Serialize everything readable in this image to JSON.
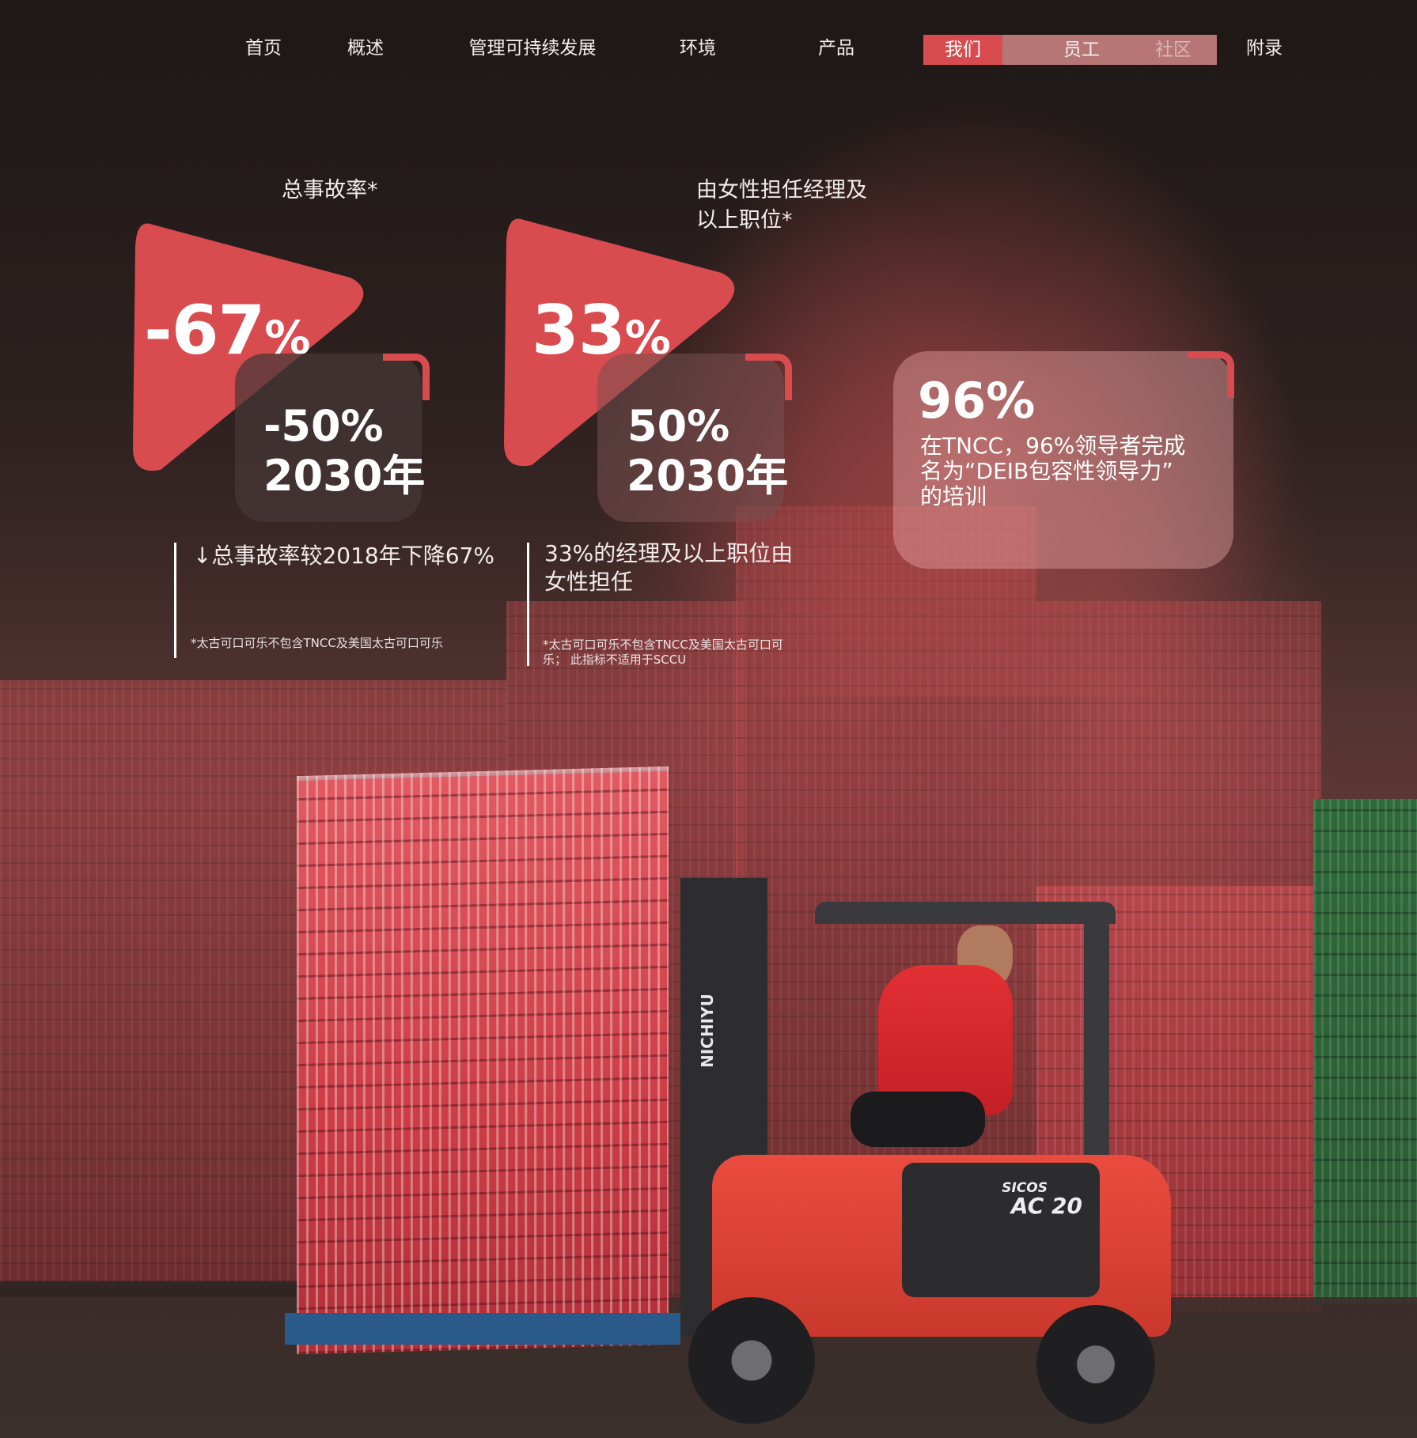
{
  "nav": {
    "items": [
      "首页",
      "概述",
      "管理可持续发展",
      "环境",
      "产品",
      "我们",
      "员工",
      "社区",
      "附录"
    ],
    "active": "我们"
  },
  "stats": {
    "accident": {
      "label": "总事故率*",
      "value": "-67",
      "pct": "%",
      "target_value": "-50%",
      "target_year": "2030年",
      "desc": "↓总事故率较2018年下降67%",
      "footnote": "*太古可口可乐不包含TNCC及美国太古可口可乐"
    },
    "women": {
      "label_line1": "由女性担任经理及",
      "label_line2": "以上职位*",
      "value": "33",
      "pct": "%",
      "target_value": "50%",
      "target_year": "2030年",
      "desc_line1": "33%的经理及以上职位由",
      "desc_line2": "女性担任",
      "footnote_line1": "*太古可口可乐不包含TNCC及美国太古可口可",
      "footnote_line2": "乐； 此指标不适用于SCCU"
    },
    "training": {
      "value": "96%",
      "desc_line1": "在TNCC，96%领导者完成",
      "desc_line2": "名为“DEIB包容性领导力”",
      "desc_line3": "的培训"
    }
  },
  "colors": {
    "accent": "#d84b4f",
    "card": "#463737",
    "nav_active_bg": "#d84b4f",
    "nav_group_bg": "#e89696"
  },
  "photo_text": {
    "mast_brand": "NICHIYU",
    "model_line1": "SICOS",
    "model_line2": "AC 20"
  }
}
